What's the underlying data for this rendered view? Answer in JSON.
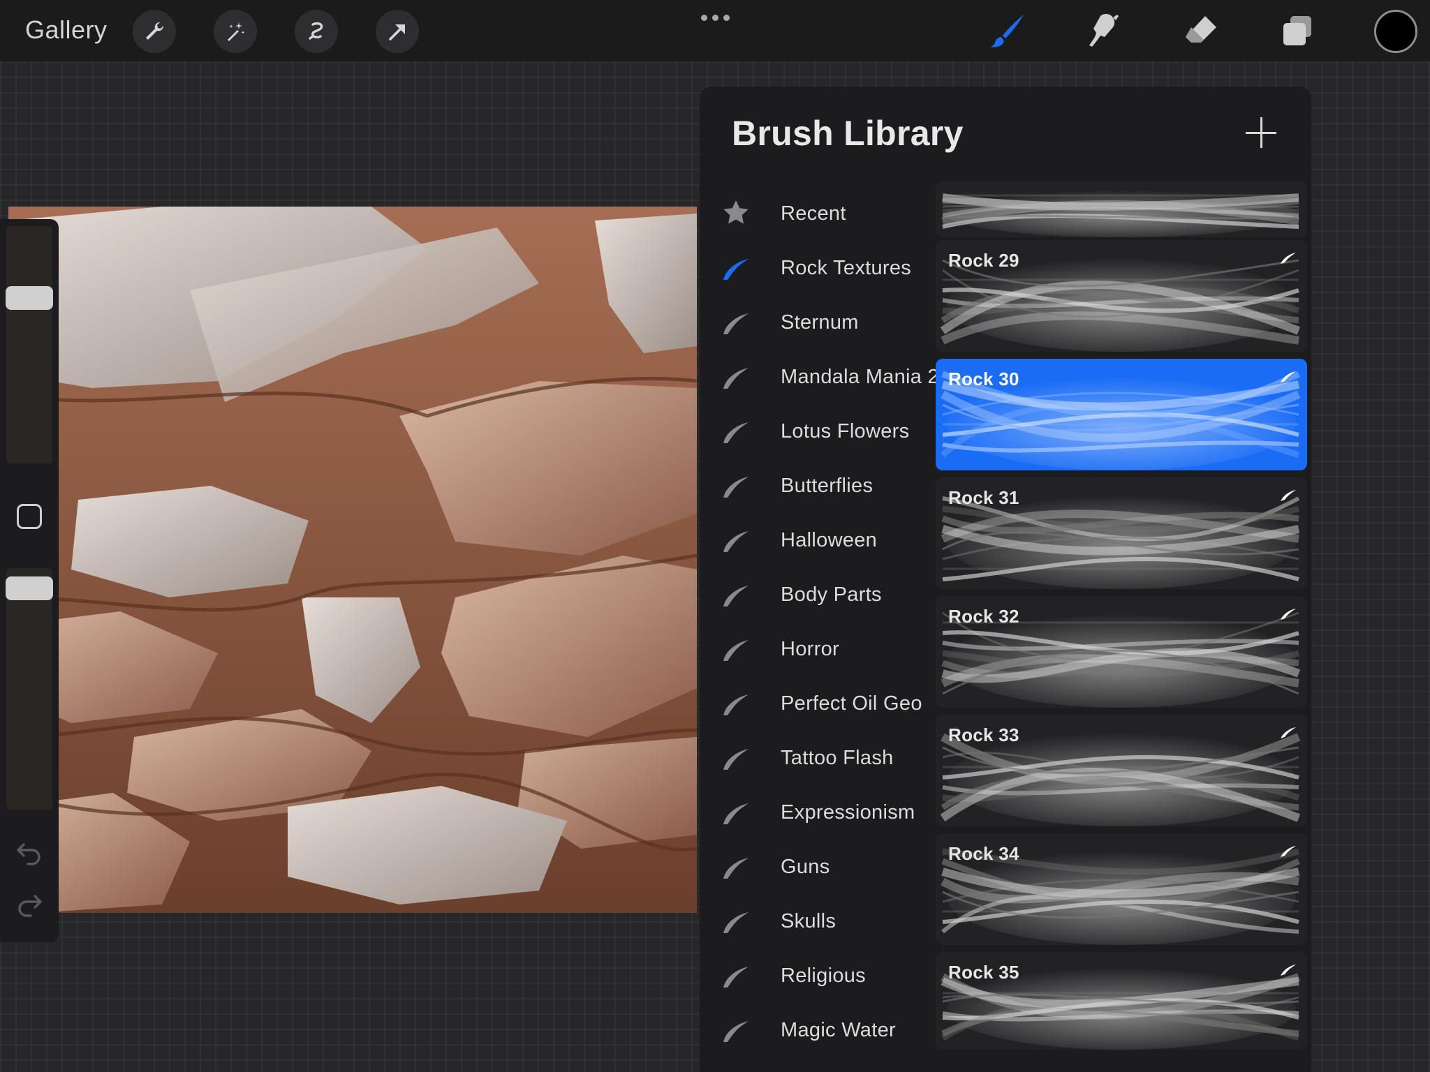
{
  "topbar": {
    "gallery_label": "Gallery",
    "tools": [
      {
        "name": "wrench-icon"
      },
      {
        "name": "magic-wand-icon"
      },
      {
        "name": "selection-icon"
      },
      {
        "name": "transform-arrow-icon"
      }
    ],
    "right_tools": [
      "brush-icon",
      "smudge-icon",
      "eraser-icon",
      "layers-icon"
    ],
    "active_tool": "brush-icon",
    "accent_color": "#1a6cf5",
    "current_color": "#000000"
  },
  "sidebar": {
    "brush_size_level": 0.32,
    "opacity_level": 0.05
  },
  "library": {
    "title": "Brush Library",
    "sets": [
      {
        "label": "Recent",
        "icon": "star-icon"
      },
      {
        "label": "Rock Textures",
        "icon": "brush-stroke-icon",
        "active": true
      },
      {
        "label": "Sternum",
        "icon": "brush-stroke-icon"
      },
      {
        "label": "Mandala Mania 2",
        "icon": "brush-stroke-icon"
      },
      {
        "label": "Lotus Flowers",
        "icon": "brush-stroke-icon"
      },
      {
        "label": "Butterflies",
        "icon": "brush-stroke-icon"
      },
      {
        "label": "Halloween",
        "icon": "brush-stroke-icon"
      },
      {
        "label": "Body Parts",
        "icon": "brush-stroke-icon"
      },
      {
        "label": "Horror",
        "icon": "brush-stroke-icon"
      },
      {
        "label": "Perfect Oil Geo",
        "icon": "brush-stroke-icon"
      },
      {
        "label": "Tattoo Flash",
        "icon": "brush-stroke-icon"
      },
      {
        "label": "Expressionism",
        "icon": "brush-stroke-icon"
      },
      {
        "label": "Guns",
        "icon": "brush-stroke-icon"
      },
      {
        "label": "Skulls",
        "icon": "brush-stroke-icon"
      },
      {
        "label": "Religious",
        "icon": "brush-stroke-icon"
      },
      {
        "label": "Magic Water",
        "icon": "brush-stroke-icon"
      }
    ],
    "brushes": [
      {
        "name": ""
      },
      {
        "name": "Rock 29"
      },
      {
        "name": "Rock 30",
        "selected": true
      },
      {
        "name": "Rock 31"
      },
      {
        "name": "Rock 32"
      },
      {
        "name": "Rock 33"
      },
      {
        "name": "Rock 34"
      },
      {
        "name": "Rock 35"
      }
    ]
  }
}
